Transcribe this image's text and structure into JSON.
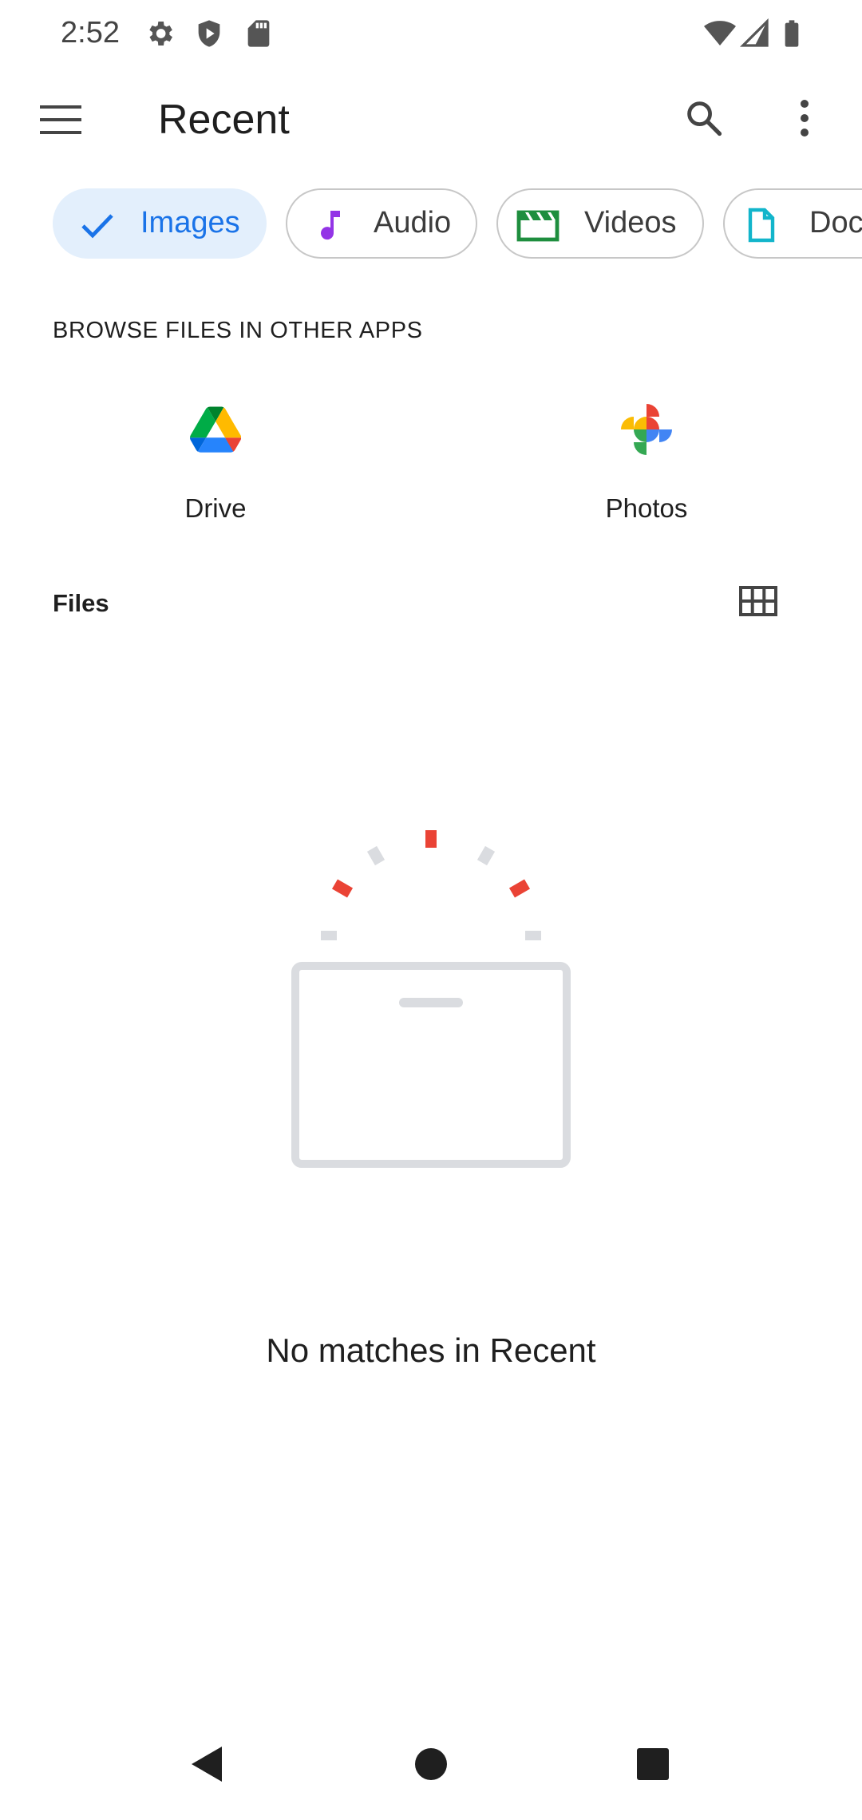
{
  "status_bar": {
    "time": "2:52",
    "icons": [
      "settings-icon",
      "shield-icon",
      "sd-card-icon",
      "wifi-icon",
      "signal-icon",
      "battery-icon"
    ]
  },
  "appbar": {
    "title": "Recent",
    "menu_icon": "menu-icon",
    "search_icon": "search-icon",
    "more_icon": "more-vert-icon"
  },
  "chips": [
    {
      "label": "Images",
      "icon": "check-icon",
      "selected": true
    },
    {
      "label": "Audio",
      "icon": "music-note-icon",
      "selected": false
    },
    {
      "label": "Videos",
      "icon": "movie-icon",
      "selected": false
    },
    {
      "label": "Doc",
      "icon": "document-icon",
      "selected": false
    }
  ],
  "browse_section": {
    "header": "BROWSE FILES IN OTHER APPS",
    "apps": [
      {
        "label": "Drive",
        "icon": "google-drive-icon"
      },
      {
        "label": "Photos",
        "icon": "google-photos-icon"
      }
    ]
  },
  "files_section": {
    "label": "Files",
    "view_toggle_icon": "grid-view-icon"
  },
  "empty_state": {
    "message": "No matches in Recent",
    "illustration": "empty-folder-illustration"
  },
  "nav": {
    "back_icon": "back-icon",
    "home_icon": "home-icon",
    "recents_icon": "recents-icon"
  },
  "colors": {
    "accent": "#1a73e8",
    "chip_selected_bg": "#e3effc",
    "audio_icon": "#9334e6",
    "video_icon": "#1e8e3e",
    "doc_icon": "#12b5cb",
    "illustration_red": "#ea4335",
    "illustration_gray": "#dadce0"
  }
}
